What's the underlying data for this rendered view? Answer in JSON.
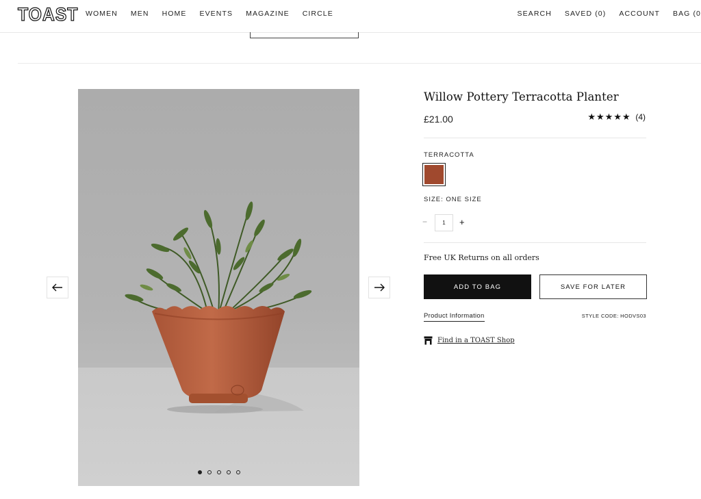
{
  "header": {
    "logo": "TOAST",
    "nav_left": [
      "WOMEN",
      "MEN",
      "HOME",
      "EVENTS",
      "MAGAZINE",
      "CIRCLE"
    ],
    "nav_right": [
      "SEARCH",
      "SAVED (0)",
      "ACCOUNT",
      "BAG (0"
    ]
  },
  "gallery": {
    "image_alt": "Terracotta planter with rosemary plant",
    "dot_count": 5,
    "active_dot": 1,
    "prev_icon": "arrow-left-icon",
    "next_icon": "arrow-right-icon"
  },
  "product": {
    "title": "Willow Pottery Terracotta Planter",
    "price": "£21.00",
    "stars": "★★★★★",
    "review_count": "(4)",
    "colour_label": "TERRACOTTA",
    "swatch_color": "#a0492e",
    "size_label": "SIZE: ONE SIZE",
    "qty_minus": "−",
    "quantity": "1",
    "qty_plus": "+",
    "returns_text": "Free UK Returns on all orders",
    "add_to_bag": "ADD TO BAG",
    "save_for_later": "SAVE FOR LATER",
    "product_info": "Product Information",
    "style_code": "STYLE CODE: HODVS03",
    "find_shop": "Find in a TOAST Shop",
    "store_icon": "store-icon"
  }
}
